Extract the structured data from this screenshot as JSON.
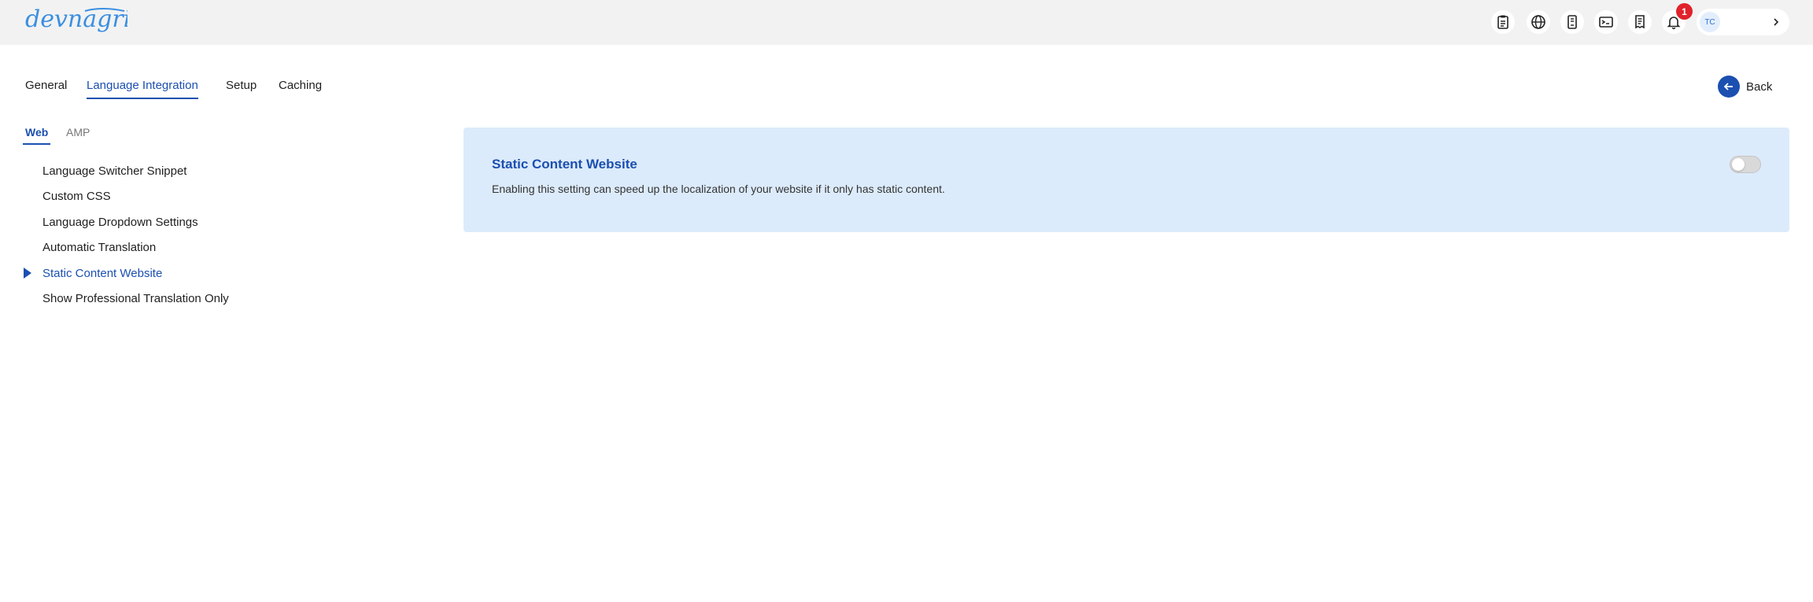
{
  "header": {
    "logo_text": "devnagri",
    "icons": [
      "clipboard-icon",
      "globe-icon",
      "document-icon",
      "terminal-icon",
      "receipt-icon",
      "bell-icon"
    ],
    "notification_count": "1",
    "user_initials": "TC"
  },
  "tabs": [
    {
      "label": "General",
      "active": false
    },
    {
      "label": "Language Integration",
      "active": true
    },
    {
      "label": "Setup",
      "active": false
    },
    {
      "label": "Caching",
      "active": false
    }
  ],
  "back_label": "Back",
  "sub_tabs": [
    {
      "label": "Web",
      "active": true
    },
    {
      "label": "AMP",
      "active": false
    }
  ],
  "sidebar": {
    "items": [
      {
        "label": "Language Switcher Snippet",
        "active": false
      },
      {
        "label": "Custom CSS",
        "active": false
      },
      {
        "label": "Language Dropdown Settings",
        "active": false
      },
      {
        "label": "Automatic Translation",
        "active": false
      },
      {
        "label": "Static Content Website",
        "active": true
      },
      {
        "label": "Show Professional Translation Only",
        "active": false
      }
    ]
  },
  "setting": {
    "title": "Static Content Website",
    "description": "Enabling this setting can speed up the localization of your website if it only has static content.",
    "enabled": false
  },
  "colors": {
    "accent": "#1b4fb0",
    "card_bg": "#dcebfb",
    "topbar_bg": "#f2f2f2",
    "badge": "#e0222b"
  }
}
